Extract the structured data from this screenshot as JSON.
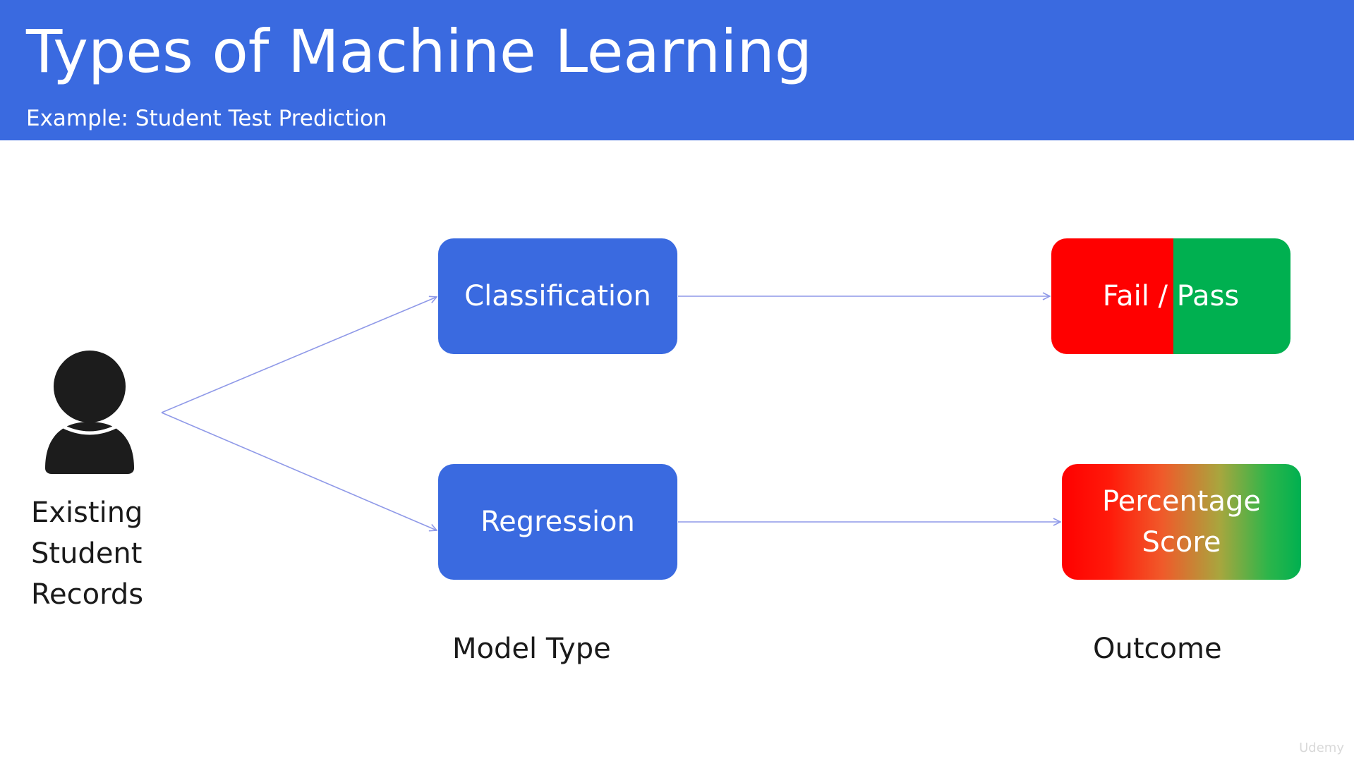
{
  "header": {
    "title": "Types of Machine Learning",
    "subtitle": "Example: Student Test Prediction"
  },
  "input": {
    "icon": "person-icon",
    "label_lines": [
      "Existing",
      "Student",
      "Records"
    ]
  },
  "model_types": {
    "classification": "Classification",
    "regression": "Regression"
  },
  "outcomes": {
    "fail": "Fail",
    "separator": " / ",
    "pass": "Pass",
    "percentage_lines": [
      "Percentage",
      "Score"
    ]
  },
  "column_labels": {
    "model_type": "Model Type",
    "outcome": "Outcome"
  },
  "watermark": "Udemy",
  "colors": {
    "header": "#3a6ae0",
    "box": "#3a6ae0",
    "fail": "#ff0000",
    "pass": "#00b050",
    "connector": "#8f99e8"
  }
}
